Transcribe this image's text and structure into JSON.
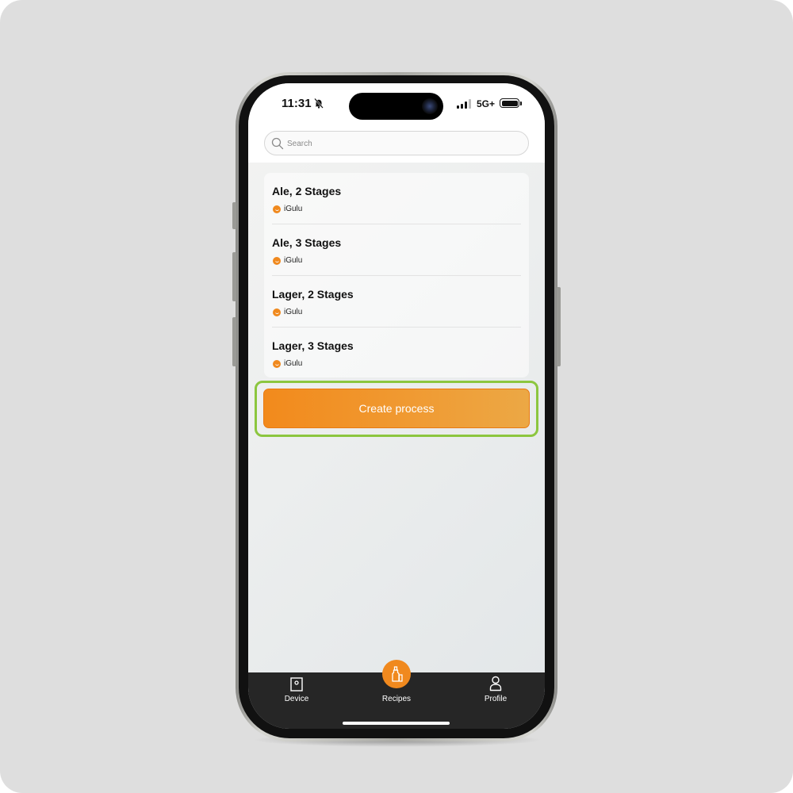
{
  "status_bar": {
    "time": "11:31",
    "network": "5G+",
    "icons": [
      "bell-slash-icon",
      "signal-icon",
      "battery-icon"
    ]
  },
  "search": {
    "placeholder": "Search",
    "icon": "search-icon"
  },
  "recipes": [
    {
      "title": "Ale, 2 Stages",
      "author": "iGulu"
    },
    {
      "title": "Ale, 3 Stages",
      "author": "iGulu"
    },
    {
      "title": "Lager, 2 Stages",
      "author": "iGulu"
    },
    {
      "title": "Lager, 3 Stages",
      "author": "iGulu"
    }
  ],
  "actions": {
    "create_label": "Create process"
  },
  "nav": {
    "items": [
      {
        "label": "Device",
        "icon": "device-icon"
      },
      {
        "label": "Recipes",
        "icon": "bottle-icon",
        "active": true
      },
      {
        "label": "Profile",
        "icon": "person-icon"
      }
    ]
  },
  "colors": {
    "accent": "#f0891e",
    "highlight": "#8cc63f",
    "nav_background": "#262626"
  }
}
